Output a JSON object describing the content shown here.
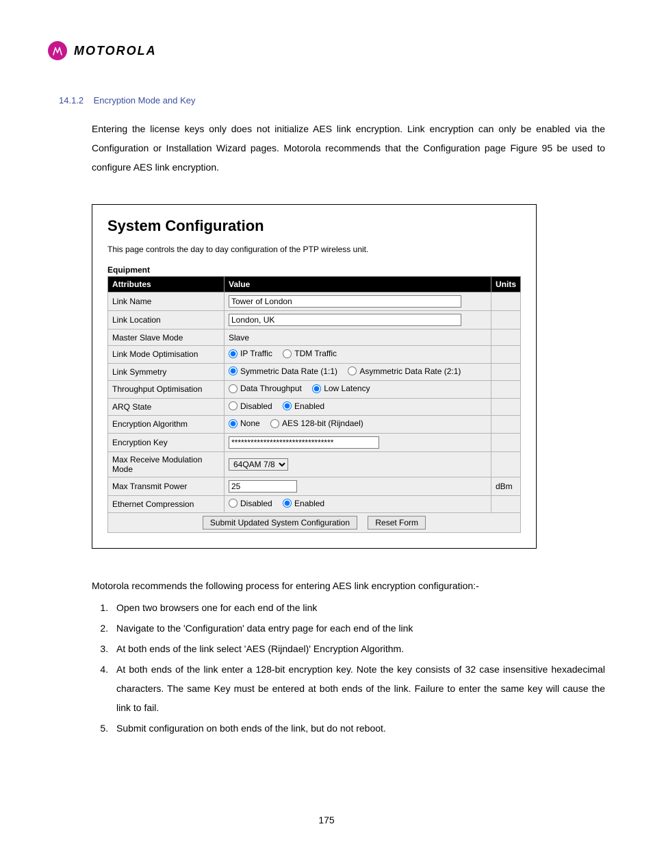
{
  "header": {
    "brand": "MOTOROLA"
  },
  "section": {
    "number": "14.1.2",
    "title": "Encryption Mode and Key"
  },
  "intro_para": "Entering the license keys only does not initialize AES link encryption. Link encryption can only be enabled via the Configuration or Installation Wizard pages. Motorola recommends that the Configuration page Figure 95 be used to configure AES link encryption.",
  "figure": {
    "title": "System Configuration",
    "subtitle": "This page controls the day to day configuration of the PTP wireless unit.",
    "equipment_label": "Equipment",
    "headers": {
      "attributes": "Attributes",
      "value": "Value",
      "units": "Units"
    },
    "rows": {
      "link_name": {
        "label": "Link Name",
        "value": "Tower of London"
      },
      "link_location": {
        "label": "Link Location",
        "value": "London, UK"
      },
      "master_slave": {
        "label": "Master Slave Mode",
        "value": "Slave"
      },
      "link_mode_opt": {
        "label": "Link Mode Optimisation",
        "opt1": "IP Traffic",
        "opt2": "TDM Traffic"
      },
      "link_symmetry": {
        "label": "Link Symmetry",
        "opt1": "Symmetric Data Rate (1:1)",
        "opt2": "Asymmetric Data Rate (2:1)"
      },
      "throughput_opt": {
        "label": "Throughput Optimisation",
        "opt1": "Data Throughput",
        "opt2": "Low Latency"
      },
      "arq_state": {
        "label": "ARQ State",
        "opt1": "Disabled",
        "opt2": "Enabled"
      },
      "encryption_alg": {
        "label": "Encryption Algorithm",
        "opt1": "None",
        "opt2": "AES 128-bit (Rijndael)"
      },
      "encryption_key": {
        "label": "Encryption Key",
        "value": "********************************"
      },
      "max_rx_mod": {
        "label": "Max Receive Modulation Mode",
        "value": "64QAM 7/8"
      },
      "max_tx_power": {
        "label": "Max Transmit Power",
        "value": "25",
        "units": "dBm"
      },
      "eth_compression": {
        "label": "Ethernet Compression",
        "opt1": "Disabled",
        "opt2": "Enabled"
      }
    },
    "buttons": {
      "submit": "Submit Updated System Configuration",
      "reset": "Reset Form"
    }
  },
  "followup": "Motorola recommends the following process for entering AES link encryption configuration:-",
  "steps": [
    "Open two browsers one for each end of the link",
    "Navigate to the 'Configuration' data entry page for each end of the link",
    "At both ends of the link select 'AES (Rijndael)' Encryption Algorithm.",
    "At both ends of the link enter a 128-bit encryption key. Note the key consists of 32 case insensitive hexadecimal characters. The same Key must be entered at both ends of the link. Failure to enter the same key will cause the link to fail.",
    "Submit configuration on both ends of the link, but do not reboot."
  ],
  "page_number": "175"
}
